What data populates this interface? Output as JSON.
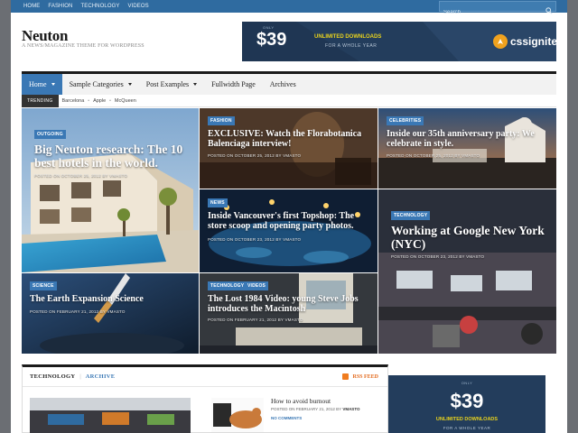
{
  "topbar": {
    "nav": [
      "HOME",
      "FASHION",
      "TECHNOLOGY",
      "VIDEOS"
    ],
    "search_placeholder": "Search"
  },
  "header": {
    "logo": "Neuton",
    "tagline": "A NEWS/MAGAZINE THEME FOR WORDPRESS"
  },
  "banner": {
    "only": "ONLY",
    "price": "$39",
    "downloads": "UNLIMITED DOWNLOADS",
    "period": "FOR A WHOLE YEAR",
    "brand": "cssigniter"
  },
  "mainnav": {
    "items": [
      "Home",
      "Sample Categories",
      "Post Examples",
      "Fullwidth Page",
      "Archives"
    ]
  },
  "trending": {
    "label": "TRENDING",
    "tags": [
      "Barcelona",
      "Apple",
      "McQueen"
    ],
    "separator": "•"
  },
  "tiles": [
    {
      "cat": "OUTGOING",
      "title": "Big Neuton research: The 10 best hotels in the world.",
      "meta": "POSTED ON OCTOBER 25, 2012 BY VMASTO"
    },
    {
      "cat": "FASHION",
      "title": "EXCLUSIVE: Watch the Florabotanica Balenciaga interview!",
      "meta": "POSTED ON OCTOBER 25, 2012 BY VMASTO"
    },
    {
      "cat": "CELEBRITIES",
      "title": "Inside our 35th anniversary party: We celebrate in style.",
      "meta": "POSTED ON OCTOBER 25, 2012 BY VMASTO"
    },
    {
      "cat": "NEWS",
      "title": "Inside Vancouver's first Topshop: The store scoop and opening party photos.",
      "meta": "POSTED ON OCTOBER 23, 2012 BY VMASTO"
    },
    {
      "cat": "TECHNOLOGY",
      "title": "Working at Google New York (NYC)",
      "meta": "POSTED ON OCTOBER 23, 2012 BY VMASTO"
    },
    {
      "cat": "SCIENCE",
      "title": "The Earth Expansion Science",
      "meta": "POSTED ON FEBRUARY 21, 2012 BY VMASTO"
    },
    {
      "cat": "TECHNOLOGY",
      "cat2": "VIDEOS",
      "title": "The Lost 1984 Video: young Steve Jobs introduces the Macintosh",
      "meta": "POSTED ON FEBRUARY 21, 2012 BY VMASTO"
    }
  ],
  "lower": {
    "section": "TECHNOLOGY",
    "separator": "|",
    "archive": "ARCHIVE",
    "rss": "RSS FEED",
    "post2_title": "How to avoid burnout",
    "post2_meta_prefix": "POSTED ON FEBRUARY 21, 2012 BY",
    "post2_author": "VMASTO",
    "post2_comments": "NO COMMENTS"
  },
  "sidead": {
    "only": "ONLY",
    "price": "$39",
    "downloads": "UNLIMITED DOWNLOADS",
    "period": "FOR A WHOLE YEAR"
  },
  "colors": {
    "topbar": "#2f6ba0",
    "accent": "#3a78b5",
    "banner": "#233d5c",
    "highlight": "#e8d21d"
  }
}
